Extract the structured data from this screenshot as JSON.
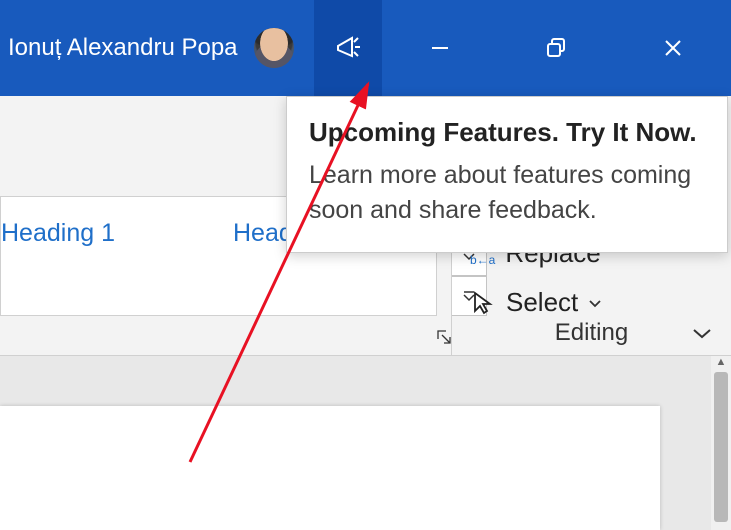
{
  "titlebar": {
    "username": "Ionuț Alexandru Popa"
  },
  "tooltip": {
    "title": "Upcoming Features. Try It Now.",
    "body": "Learn more about features coming soon and share feedback."
  },
  "ribbon": {
    "styles": {
      "heading1": "Heading 1",
      "heading2": "Heading 2"
    },
    "editing": {
      "replace": "Replace",
      "select": "Select",
      "group_label": "Editing"
    }
  }
}
